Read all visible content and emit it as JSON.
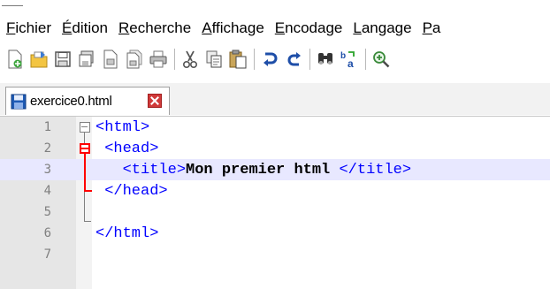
{
  "menu": [
    {
      "accel": "F",
      "rest": "ichier"
    },
    {
      "accel": "É",
      "rest": "dition"
    },
    {
      "accel": "R",
      "rest": "echerche"
    },
    {
      "accel": "A",
      "rest": "ffichage"
    },
    {
      "accel": "E",
      "rest": "ncodage"
    },
    {
      "accel": "L",
      "rest": "angage"
    },
    {
      "accel": "P",
      "rest": "a"
    }
  ],
  "toolbar_icons": [
    "new-file-icon",
    "open-file-icon",
    "save-icon",
    "save-all-icon",
    "close-icon",
    "close-all-icon",
    "print-icon",
    "cut-icon",
    "copy-icon",
    "paste-icon",
    "undo-icon",
    "redo-icon",
    "find-icon",
    "replace-icon",
    "zoom-in-icon"
  ],
  "tab": {
    "label": "exercice0.html"
  },
  "editor": {
    "lines": [
      {
        "n": "1",
        "tag": "<html>",
        "text": "",
        "end": ""
      },
      {
        "n": "2",
        "tag": " <head>",
        "text": "",
        "end": ""
      },
      {
        "n": "3",
        "tag": "   <title>",
        "text": "Mon premier html ",
        "end": "</title>"
      },
      {
        "n": "4",
        "tag": " </head>",
        "text": "",
        "end": ""
      },
      {
        "n": "5",
        "tag": "",
        "text": "",
        "end": ""
      },
      {
        "n": "6",
        "tag": "</html>",
        "text": "",
        "end": ""
      },
      {
        "n": "7",
        "tag": "",
        "text": "",
        "end": ""
      }
    ],
    "current_line": 3,
    "colors": {
      "tag": "#0000ff",
      "text": "#000000",
      "current_line_bg": "#e8e8ff",
      "fold_red": "#ff0000"
    }
  }
}
